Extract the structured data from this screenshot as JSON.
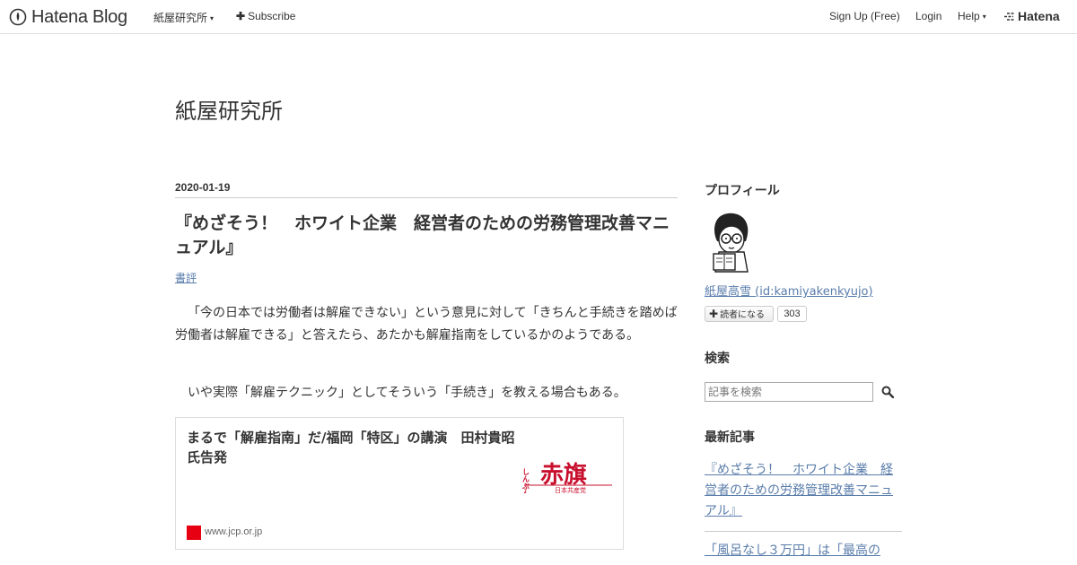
{
  "topbar": {
    "logo_text": "Hatena Blog",
    "blog_menu_label": "紙屋研究所",
    "subscribe_label": "Subscribe",
    "signup_label": "Sign Up (Free)",
    "login_label": "Login",
    "help_label": "Help",
    "hatena_label": "Hatena"
  },
  "blog": {
    "title": "紙屋研究所"
  },
  "entry": {
    "date": "2020-01-19",
    "title": "『めざそう！　ホワイト企業　経営者のための労務管理改善マニュアル』",
    "category": "書評",
    "paragraphs": [
      "「今の日本では労働者は解雇できない」という意見に対して「きちんと手続きを踏めば労働者は解雇できる」と答えたら、あたかも解雇指南をしているかのようである。",
      "いや実際「解雇テクニック」としてそういう「手続き」を教える場合もある。"
    ]
  },
  "embed_card": {
    "title": "まるで「解雇指南」だ/福岡「特区」の講演　田村貴昭氏告発",
    "domain": "www.jcp.or.jp",
    "logo_small": "しんぶん",
    "logo_main": "赤旗",
    "logo_sub": "日本共産党",
    "logo_color": "#c8102e"
  },
  "sidebar": {
    "profile_heading": "プロフィール",
    "profile_name": "紙屋高雪 (id:kamiyakenkyujo)",
    "subscribe_label": "読者になる",
    "subscriber_count": "303",
    "search_heading": "検索",
    "search_placeholder": "記事を検索",
    "recent_heading": "最新記事",
    "recent_items": [
      "『めざそう！　ホワイト企業　経営者のための労務管理改善マニュアル』",
      "「風呂なし３万円」は「最高の"
    ]
  },
  "colors": {
    "link": "#5a7dab",
    "text": "#333333",
    "favicon": "#e60012"
  },
  "icons": [
    "hatena-blog-logo-icon",
    "caret-down-icon",
    "plus-icon",
    "hatena-logo-icon",
    "search-icon",
    "avatar-icon",
    "favicon-icon"
  ]
}
